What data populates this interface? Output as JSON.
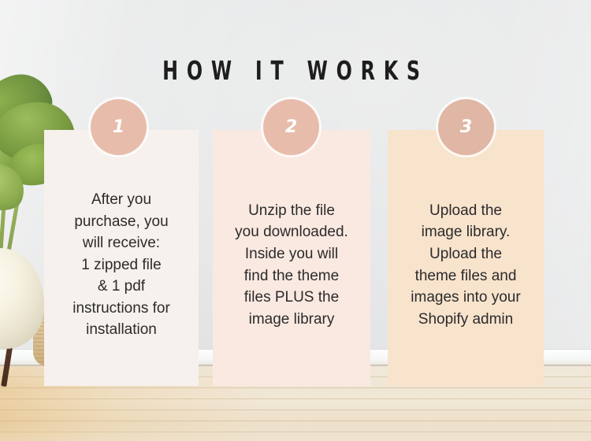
{
  "heading": {
    "title": "HOW IT WORKS"
  },
  "theme": {
    "wall_color": "#e6e7e8",
    "floor_color": "#efe5d3",
    "badge_color": "#e8bcab",
    "badge_text_color": "#ffffff",
    "title_color": "#1d1d1d",
    "body_text_color": "#2b2b2b",
    "card_1_color": "#f7f1ed",
    "card_2_color": "#fae9e1",
    "card_3_color": "#f8e3cd"
  },
  "steps": [
    {
      "number": "1",
      "badge_color": "#e8bcab",
      "card_color": "#f7f1ed",
      "text": "After you\npurchase, you\nwill receive:\n1 zipped file\n& 1 pdf\ninstructions for\ninstallation"
    },
    {
      "number": "2",
      "badge_color": "#e8bcab",
      "card_color": "#fae9e1",
      "text": "Unzip the file\nyou downloaded.\nInside you will\nfind the theme\nfiles PLUS the\nimage library"
    },
    {
      "number": "3",
      "badge_color": "#e0b6a4",
      "card_color": "#f8e3cd",
      "text": "Upload the\nimage library.\nUpload the\ntheme files and\nimages into your\nShopify admin"
    }
  ],
  "decor": {
    "plant_name": "monstera-plant",
    "pot_name": "planter-pot",
    "basket_name": "woven-basket",
    "floor_name": "wood-floor",
    "wall_name": "interior-wall"
  }
}
